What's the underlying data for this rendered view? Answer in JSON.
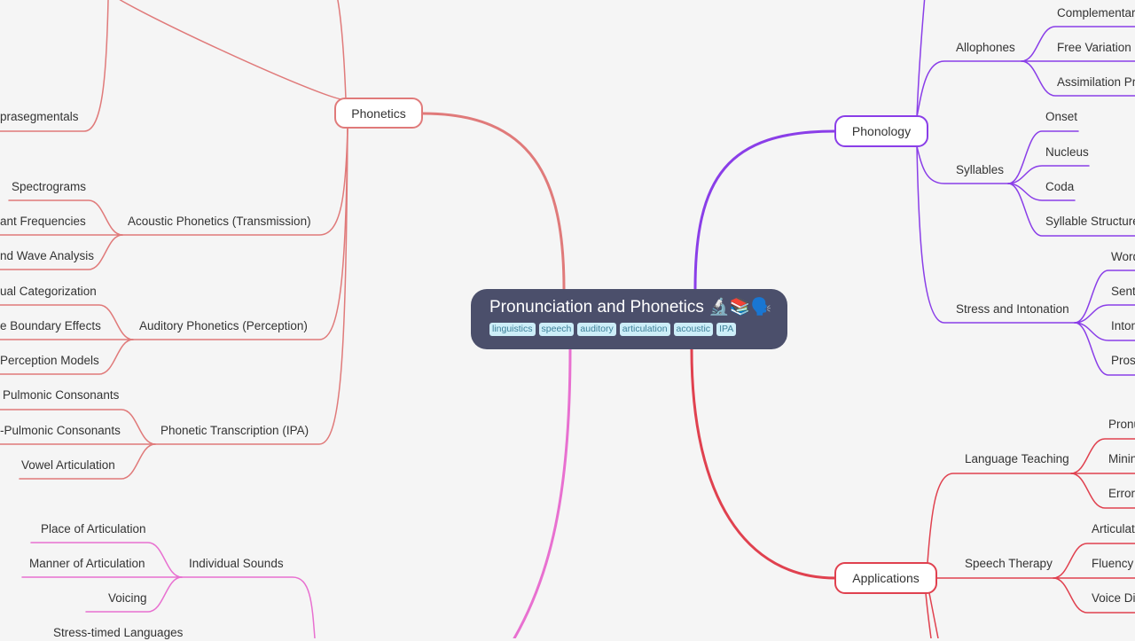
{
  "root": {
    "title": "Pronunciation and Phonetics 🔬📚🗣️",
    "tags": [
      "linguistics",
      "speech",
      "auditory",
      "articulation",
      "acoustic",
      "IPA"
    ]
  },
  "colors": {
    "phonetics": "#e07a7a",
    "phonology": "#8a3ee8",
    "applications": "#e0414f",
    "pink": "#e870d0",
    "root_bg": "#4b4f6b",
    "tag_bg": "#cdeef8"
  },
  "phonetics": {
    "label": "Phonetics",
    "suprasegmentals": "prasegmentals",
    "acoustic": {
      "label": "Acoustic Phonetics (Transmission)",
      "children": [
        "Spectrograms",
        "ant Frequencies",
        "nd Wave Analysis"
      ]
    },
    "auditory": {
      "label": "Auditory Phonetics (Perception)",
      "children": [
        "ual Categorization",
        "e Boundary Effects",
        "Perception Models"
      ]
    },
    "ipa": {
      "label": "Phonetic Transcription (IPA)",
      "children": [
        "Pulmonic Consonants",
        "-Pulmonic Consonants",
        "Vowel Articulation"
      ]
    }
  },
  "segmentals": {
    "individual_sounds": {
      "label": "Individual Sounds",
      "children": [
        "Place of Articulation",
        "Manner of Articulation",
        "Voicing"
      ]
    },
    "stress_timed": "Stress-timed Languages"
  },
  "phonology": {
    "label": "Phonology",
    "allophones": {
      "label": "Allophones",
      "children": [
        "Complementar",
        "Free Variation",
        "Assimilation Pr"
      ]
    },
    "syllables": {
      "label": "Syllables",
      "children": [
        "Onset",
        "Nucleus",
        "Coda",
        "Syllable Structure"
      ]
    },
    "stress": {
      "label": "Stress and Intonation",
      "children": [
        "Word",
        "Sent",
        "Inton",
        "Pros"
      ]
    }
  },
  "applications": {
    "label": "Applications",
    "teaching": {
      "label": "Language Teaching",
      "children": [
        "Pronu",
        "Minin",
        "Error"
      ]
    },
    "therapy": {
      "label": "Speech Therapy",
      "children": [
        "Articulat",
        "Fluency",
        "Voice Dis"
      ]
    }
  }
}
